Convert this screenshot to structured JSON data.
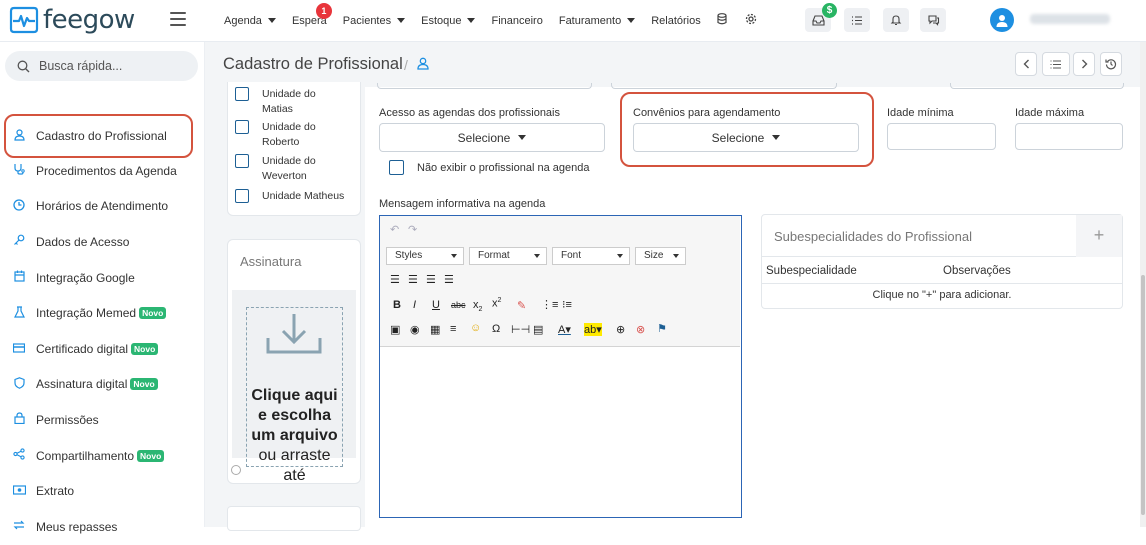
{
  "app": {
    "logo_text": "feegow"
  },
  "topnav": {
    "items": [
      {
        "label": "Agenda",
        "dropdown": true
      },
      {
        "label": "Espera",
        "dropdown": false,
        "badge": "1"
      },
      {
        "label": "Pacientes",
        "dropdown": true
      },
      {
        "label": "Estoque",
        "dropdown": true
      },
      {
        "label": "Financeiro",
        "dropdown": false
      },
      {
        "label": "Faturamento",
        "dropdown": true
      },
      {
        "label": "Relatórios",
        "dropdown": false
      }
    ],
    "icons": [
      "database-icon",
      "settings-icon"
    ],
    "toolbar_buttons": [
      "inbox-icon",
      "tasks-icon",
      "bell-icon",
      "chat-icon"
    ],
    "money_badge": "$"
  },
  "sidebar": {
    "search_placeholder": "Busca rápida...",
    "items": [
      {
        "label": "Cadastro do Profissional",
        "icon": "user-icon",
        "active": true
      },
      {
        "label": "Procedimentos da Agenda",
        "icon": "stethoscope-icon"
      },
      {
        "label": "Horários de Atendimento",
        "icon": "clock-icon"
      },
      {
        "label": "Dados de Acesso",
        "icon": "key-icon"
      },
      {
        "label": "Integração Google",
        "icon": "calendar-icon"
      },
      {
        "label": "Integração Memed",
        "icon": "flask-icon",
        "badge": "Novo"
      },
      {
        "label": "Certificado digital",
        "icon": "card-icon",
        "badge": "Novo"
      },
      {
        "label": "Assinatura digital",
        "icon": "shield-icon",
        "badge": "Novo"
      },
      {
        "label": "Permissões",
        "icon": "lock-icon"
      },
      {
        "label": "Compartilhamento",
        "icon": "share-icon",
        "badge": "Novo"
      },
      {
        "label": "Extrato",
        "icon": "money-icon"
      },
      {
        "label": "Meus repasses",
        "icon": "transfer-icon"
      }
    ]
  },
  "page": {
    "title": "Cadastro de Profissional",
    "breadcrumb_sep": "/"
  },
  "units": [
    "Unidade do Matias",
    "Unidade do Roberto",
    "Unidade do Weverton",
    "Unidade Matheus"
  ],
  "form": {
    "acesso_label": "Acesso as agendas dos profissionais",
    "acesso_value": "Selecione",
    "convenios_label": "Convênios para agendamento",
    "convenios_value": "Selecione",
    "idade_min_label": "Idade mínima",
    "idade_max_label": "Idade máxima",
    "nao_exibir_label": "Não exibir o profissional na agenda",
    "mensagem_label": "Mensagem informativa na agenda"
  },
  "editor": {
    "combos": [
      "Styles",
      "Format",
      "Font",
      "Size"
    ]
  },
  "assinatura": {
    "title": "Assinatura",
    "upload_bold": "Clique aqui e escolha um arquivo",
    "upload_rest": " ou arraste até"
  },
  "subespecialidades": {
    "title": "Subespecialidades do Profissional",
    "add": "+",
    "col1": "Subespecialidade",
    "col2": "Observações",
    "empty": "Clique no \"+\" para adicionar."
  }
}
